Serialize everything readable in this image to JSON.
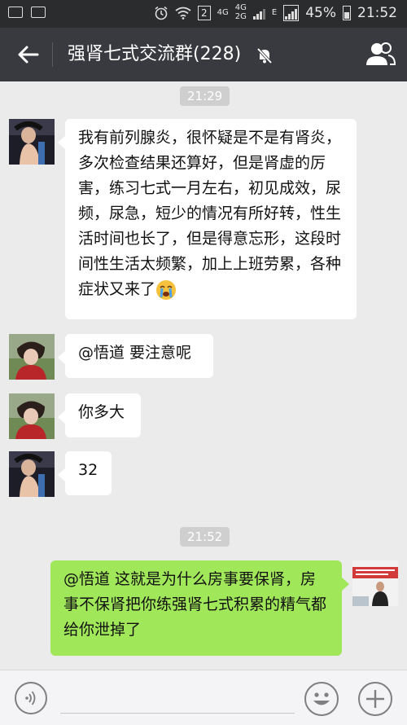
{
  "status_bar": {
    "network_small_1": "4G",
    "network_small_2": "4G",
    "network_small_3": "2G",
    "sim_label": "2",
    "data_indicator": "E",
    "battery_percent": "45%",
    "clock": "21:52"
  },
  "header": {
    "title": "强肾七式交流群(228)",
    "muted": true
  },
  "chat": {
    "time_1": "21:29",
    "time_2": "21:52",
    "messages": [
      {
        "side": "left",
        "text": "我有前列腺炎，很怀疑是不是有肾炎，多次检查结果还算好，但是肾虚的厉害，练习七式一月左右，初见成效，尿频，尿急，短少的情况有所好转，性生活时间也长了，但是得意忘形，这段时间性生活太频繁，加上上班劳累，各种症状又来了"
      },
      {
        "side": "left",
        "text": "@悟道 要注意呢"
      },
      {
        "side": "left",
        "text": "你多大"
      },
      {
        "side": "left",
        "text": "32"
      },
      {
        "side": "right",
        "text": "@悟道 这就是为什么房事要保肾，房事不保肾把你练强肾七式积累的精气都给你泄掉了"
      }
    ]
  },
  "colors": {
    "app_bar": "#393a3f",
    "background": "#ebebeb",
    "own_bubble": "#a0e75a"
  },
  "input": {
    "value": ""
  }
}
